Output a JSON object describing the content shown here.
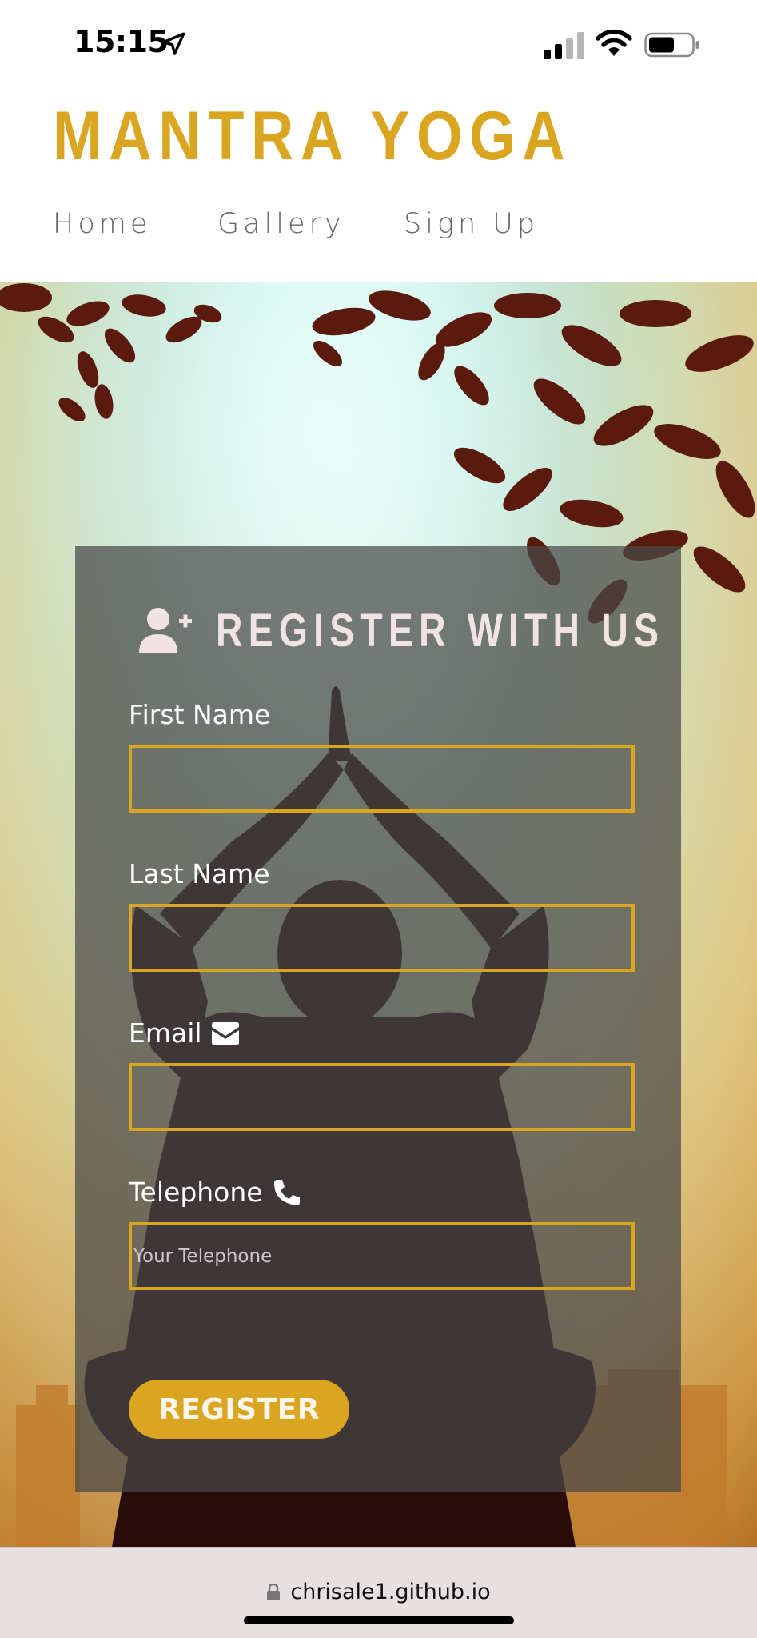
{
  "status_bar": {
    "time": "15:15",
    "icons": [
      "location-arrow-icon",
      "cellular-signal-icon",
      "wifi-icon",
      "battery-icon"
    ]
  },
  "site": {
    "brand": "MANTRA YOGA",
    "nav": [
      {
        "label": "Home"
      },
      {
        "label": "Gallery"
      },
      {
        "label": "Sign Up"
      }
    ]
  },
  "form": {
    "title": "REGISTER WITH US",
    "title_icon": "user-plus-icon",
    "fields": [
      {
        "label": "First Name",
        "placeholder": "",
        "icon": null
      },
      {
        "label": "Last Name",
        "placeholder": "",
        "icon": null
      },
      {
        "label": "Email",
        "placeholder": "",
        "icon": "envelope-icon"
      },
      {
        "label": "Telephone",
        "placeholder": "Your Telephone",
        "icon": "phone-icon"
      }
    ],
    "submit_label": "REGISTER"
  },
  "browser": {
    "url": "chrisale1.github.io",
    "url_icon": "lock-icon"
  },
  "colors": {
    "brand_gold": "#daa520",
    "nav_text": "#666666",
    "panel_overlay": "rgba(72,72,72,0.72)",
    "title_text": "#f2e3e3"
  }
}
